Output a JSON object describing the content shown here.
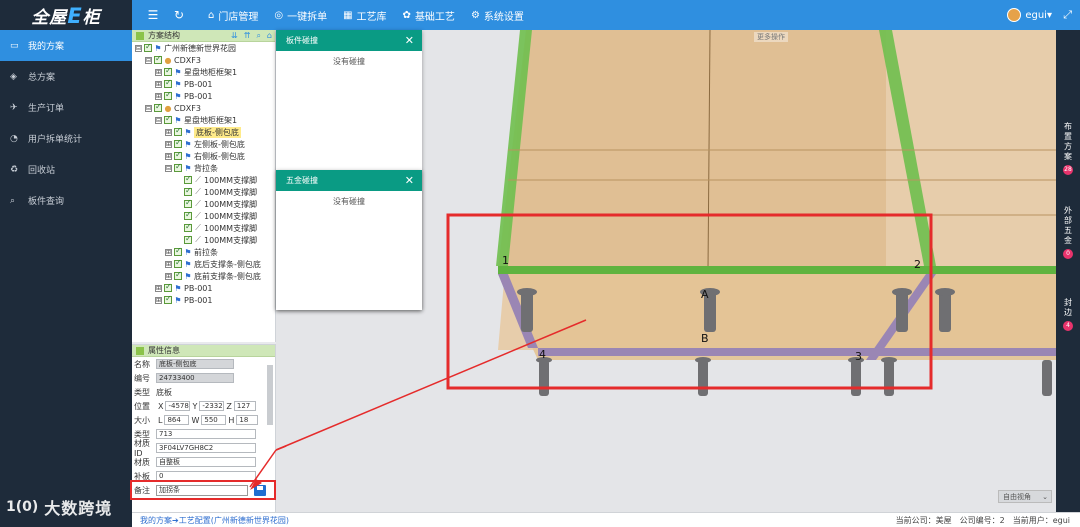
{
  "app": {
    "logo_pre": "全屋",
    "logo_e": "E",
    "logo_post": "柜"
  },
  "topnav": {
    "items": [
      {
        "icon": "⌂",
        "label": "门店管理"
      },
      {
        "icon": "◎",
        "label": "一键拆单"
      },
      {
        "icon": "▦",
        "label": "工艺库"
      },
      {
        "icon": "✿",
        "label": "基础工艺"
      },
      {
        "icon": "⚙",
        "label": "系统设置"
      }
    ],
    "user": "egui"
  },
  "sidebar": {
    "items": [
      {
        "icon": "▭",
        "label": "我的方案"
      },
      {
        "icon": "◈",
        "label": "总方案"
      },
      {
        "icon": "✈",
        "label": "生产订单"
      },
      {
        "icon": "◔",
        "label": "用户拆单统计"
      },
      {
        "icon": "♻",
        "label": "回收站"
      },
      {
        "icon": "⌕",
        "label": "板件查询"
      }
    ],
    "watermark_logo": "1(0)",
    "watermark_text": "大数跨境"
  },
  "tree": {
    "title": "方案结构",
    "rows": [
      {
        "indent": 0,
        "toggle": "⊟",
        "icon": "flag",
        "label": "广州新德新世界花园",
        "hl": false
      },
      {
        "indent": 1,
        "toggle": "⊟",
        "icon": "folder",
        "label": "CDXF3",
        "hl": false
      },
      {
        "indent": 2,
        "toggle": "⊞",
        "icon": "flag",
        "label": "星盘地柜框架1",
        "hl": false
      },
      {
        "indent": 2,
        "toggle": "⊞",
        "icon": "flag",
        "label": "PB-001",
        "hl": false
      },
      {
        "indent": 2,
        "toggle": "⊞",
        "icon": "flag",
        "label": "PB-001",
        "hl": false
      },
      {
        "indent": 1,
        "toggle": "⊟",
        "icon": "folder",
        "label": "CDXF3",
        "hl": false
      },
      {
        "indent": 2,
        "toggle": "⊟",
        "icon": "flag",
        "label": "星盘地柜框架1",
        "hl": false
      },
      {
        "indent": 3,
        "toggle": "⊞",
        "icon": "flag",
        "label": "底板-侧包底",
        "hl": true
      },
      {
        "indent": 3,
        "toggle": "⊞",
        "icon": "flag",
        "label": "左侧板-侧包底",
        "hl": false
      },
      {
        "indent": 3,
        "toggle": "⊞",
        "icon": "flag",
        "label": "右侧板-侧包底",
        "hl": false
      },
      {
        "indent": 3,
        "toggle": "⊟",
        "icon": "flag",
        "label": "背拉条",
        "hl": false
      },
      {
        "indent": 4,
        "toggle": "",
        "icon": "tool",
        "label": "100MM支撑脚",
        "hl": false
      },
      {
        "indent": 4,
        "toggle": "",
        "icon": "tool",
        "label": "100MM支撑脚",
        "hl": false
      },
      {
        "indent": 4,
        "toggle": "",
        "icon": "tool",
        "label": "100MM支撑脚",
        "hl": false
      },
      {
        "indent": 4,
        "toggle": "",
        "icon": "tool",
        "label": "100MM支撑脚",
        "hl": false
      },
      {
        "indent": 4,
        "toggle": "",
        "icon": "tool",
        "label": "100MM支撑脚",
        "hl": false
      },
      {
        "indent": 4,
        "toggle": "",
        "icon": "tool",
        "label": "100MM支撑脚",
        "hl": false
      },
      {
        "indent": 3,
        "toggle": "⊞",
        "icon": "flag",
        "label": "前拉条",
        "hl": false
      },
      {
        "indent": 3,
        "toggle": "⊞",
        "icon": "flag",
        "label": "底后支撑条-侧包底",
        "hl": false
      },
      {
        "indent": 3,
        "toggle": "⊞",
        "icon": "flag",
        "label": "底前支撑条-侧包底",
        "hl": false
      },
      {
        "indent": 2,
        "toggle": "⊞",
        "icon": "flag",
        "label": "PB-001",
        "hl": false
      },
      {
        "indent": 2,
        "toggle": "⊞",
        "icon": "flag",
        "label": "PB-001",
        "hl": false
      }
    ]
  },
  "props": {
    "title": "属性信息",
    "name_label": "名称",
    "name": "底板-侧包底",
    "code_label": "编号",
    "code": "24733400",
    "type_label": "类型",
    "type": "底板",
    "pos_label": "位置",
    "x_label": "X",
    "x": "-4578.",
    "y_label": "Y",
    "y": "-2332",
    "z_label": "Z",
    "z": "127",
    "size_label": "大小",
    "l_label": "L",
    "l": "864",
    "w_label": "W",
    "w": "550",
    "h_label": "H",
    "h": "18",
    "kind_label": "类型",
    "kind": "713",
    "matid_label": "材质ID",
    "matid": "3F04LV7GH8C2",
    "mat_label": "材质",
    "mat": "自整板",
    "extra_label": "补板",
    "extra": "0",
    "remark_label": "备注",
    "remark": "加拐条"
  },
  "dialogs": {
    "board_title": "板件碰撞",
    "board_body": "没有碰撞",
    "hw_title": "五金碰撞",
    "hw_body": "没有碰撞",
    "close": "✕"
  },
  "viewport": {
    "more_ops": "更多操作",
    "view_select": "自由视角",
    "labels": [
      "1",
      "2",
      "3",
      "4",
      "A",
      "B"
    ]
  },
  "right_rail": [
    {
      "label": "布置方案",
      "badge": "28"
    },
    {
      "label": "外部五金",
      "badge": "0"
    },
    {
      "label": "封边",
      "badge": "4"
    }
  ],
  "status": {
    "breadcrumb": "我的方案➔工艺配置(广州新德新世界花园)",
    "company": "当前公司：美屋",
    "company_no": "公司编号：2",
    "user": "当前用户：egui"
  },
  "colors": {
    "accent": "#2f8fe0",
    "sidebar": "#1e2b3a",
    "dialog": "#0a9b84",
    "annotation": "#e52b2b",
    "badge": "#e8336c"
  }
}
